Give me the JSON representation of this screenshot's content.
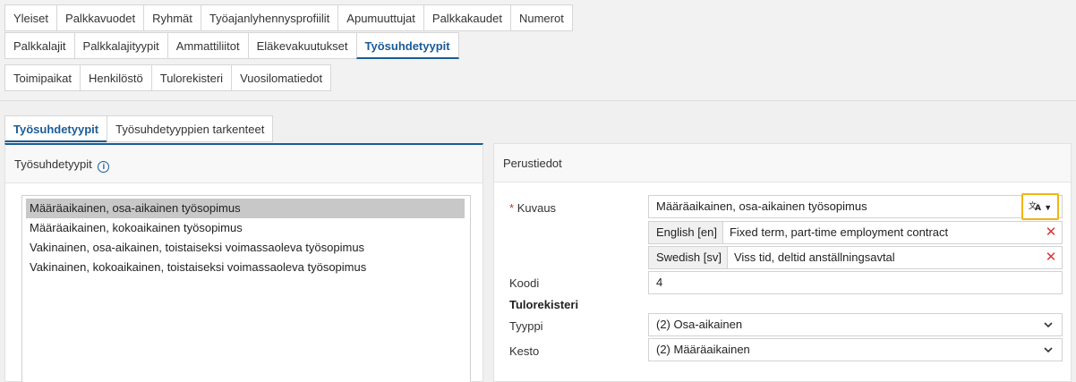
{
  "top_tabs_row1": [
    "Yleiset",
    "Palkkavuodet",
    "Ryhmät",
    "Työajanlyhennysprofiilit",
    "Apumuuttujat",
    "Palkkakaudet",
    "Numerot"
  ],
  "top_tabs_row2": [
    "Palkkalajit",
    "Palkkalajityypit",
    "Ammattiliitot",
    "Eläkevakuutukset",
    "Työsuhdetyypit"
  ],
  "top_tabs_row3": [
    "Toimipaikat",
    "Henkilöstö",
    "Tulorekisteri",
    "Vuosilomatiedot"
  ],
  "sub_tabs": [
    "Työsuhdetyypit",
    "Työsuhdetyyppien tarkenteet"
  ],
  "left_panel": {
    "title": "Työsuhdetyypit",
    "items": [
      "Määräaikainen, osa-aikainen työsopimus",
      "Määräaikainen, kokoaikainen työsopimus",
      "Vakinainen, osa-aikainen, toistaiseksi voimassaoleva työsopimus",
      "Vakinainen, kokoaikainen, toistaiseksi voimassaoleva työsopimus"
    ]
  },
  "right_panel": {
    "title": "Perustiedot",
    "kuvaus_label": "Kuvaus",
    "required_mark": "*",
    "kuvaus_value": "Määräaikainen, osa-aikainen työsopimus",
    "translations": [
      {
        "lang": "English [en]",
        "value": "Fixed term, part-time employment contract"
      },
      {
        "lang": "Swedish [sv]",
        "value": "Viss tid, deltid anställningsavtal"
      }
    ],
    "koodi_label": "Koodi",
    "koodi_value": "4",
    "section_title": "Tulorekisteri",
    "tyyppi_label": "Tyyppi",
    "tyyppi_value": "(2) Osa-aikainen",
    "kesto_label": "Kesto",
    "kesto_value": "(2) Määräaikainen"
  },
  "icons": {
    "info": "i",
    "translate": "translate-icon",
    "chevron": "chevron-down-icon",
    "delete": "close-icon"
  }
}
